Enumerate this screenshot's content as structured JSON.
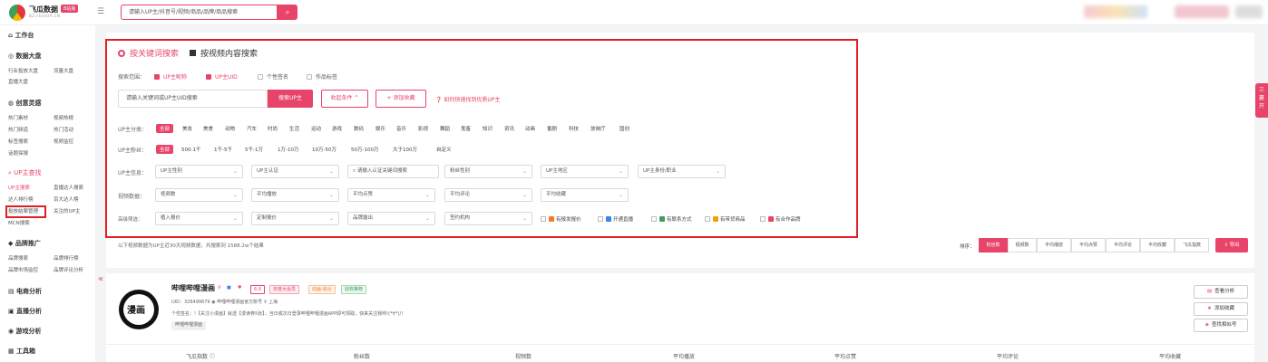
{
  "header": {
    "logo_title": "飞瓜数据",
    "logo_badge": "B站版",
    "logo_sub": "BZ.FEIGUA.CN",
    "menu_icon": "☰",
    "search_placeholder": "请输入UP主/抖音号/视频/商品/品牌/商品搜索",
    "search_icon": "⌕"
  },
  "sidebar": {
    "groups": [
      {
        "title": "⌂ 工作台"
      },
      {
        "title": "◎ 数据大盘"
      },
      {
        "title": "◍ 创意灵感"
      },
      {
        "title": "⌕ UP主查找"
      },
      {
        "title": "◆ 品牌推广"
      },
      {
        "title": "▤ 电商分析"
      },
      {
        "title": "▣ 直播分析"
      },
      {
        "title": "◉ 游戏分析"
      },
      {
        "title": "▦ 工具箱"
      }
    ],
    "items": [
      "行业投放大盘",
      "流量大盘",
      "直播大盘",
      "热门素材",
      "视频热榜",
      "热门频道",
      "热门活动",
      "标签搜索",
      "视频监控",
      "话题探搜",
      "UP主搜索",
      "直播达人搜索",
      "达人排行榜",
      "百大达人榜",
      "投放结案管理",
      "关注的UP主",
      "MCN搜索",
      "品牌搜索",
      "品牌排行榜",
      "品牌市场监控",
      "品牌评论分析"
    ],
    "collapse_icon": "«"
  },
  "search_panel": {
    "tab_keyword": "按关键词搜索",
    "tab_video": "按视频内容搜索",
    "scope_label": "搜索范围：",
    "scope_options": [
      {
        "label": "UP主昵称",
        "checked": true
      },
      {
        "label": "UP主UID",
        "checked": true
      },
      {
        "label": "个性签名",
        "checked": false
      },
      {
        "label": "作品标签",
        "checked": false
      }
    ],
    "keyword_placeholder": "请输入关键词或UP主UID搜索",
    "search_button": "搜索UP主",
    "collect_button": "收起条件 ^",
    "add_collection_button": "+ 添加收藏",
    "help_text": "❓ 如何快速找到优质UP主",
    "category_label": "UP主分类：",
    "categories": [
      "全部",
      "美妆",
      "美食",
      "动物",
      "汽车",
      "时尚",
      "生活",
      "运动",
      "游戏",
      "数码",
      "娱乐",
      "音乐",
      "影视",
      "舞蹈",
      "鬼畜",
      "知识",
      "资讯",
      "动画",
      "番剧",
      "科技",
      "放映厅",
      "国创"
    ],
    "fans_label": "UP主粉丝：",
    "fans_ranges": [
      "全部",
      "500-1千",
      "1千-5千",
      "5千-1万",
      "1万-10万",
      "10万-50万",
      "50万-100万",
      "大于100万",
      "自定义"
    ],
    "info_label": "UP主信息：",
    "info_dropdowns": [
      "UP主性别",
      "UP主认证",
      "⌕ 请输入认证关键词搜索",
      "粉丝性别",
      "UP主地区",
      "UP主身份/职业"
    ],
    "video_label": "视频数据：",
    "video_dropdowns": [
      "视频数",
      "平均播放",
      "平均点赞",
      "平均评论",
      "平均收藏"
    ],
    "advanced_label": "高级筛选：",
    "advanced_dropdowns": [
      "植入报价",
      "定制报价",
      "品牌露出",
      "签约机构"
    ],
    "advanced_checks": [
      {
        "label": "有报发报价",
        "color": "#f07c2a"
      },
      {
        "label": "开通直播",
        "color": "#3b82f6"
      },
      {
        "label": "有联系方式",
        "color": "#3aa05a"
      },
      {
        "label": "有带货商品",
        "color": "#f59e0b"
      },
      {
        "label": "有合作品牌",
        "color": "#e8446a"
      }
    ]
  },
  "results_bar": {
    "summary": "以下视频数据为UP主近30天视频数据，共搜索到 1588.2w个结果",
    "sort_label": "排序：",
    "sort_options": [
      "粉丝数",
      "视频数",
      "平均播放",
      "平均点赞",
      "平均评论",
      "平均收藏",
      "飞瓜指数"
    ],
    "export_button": "导出"
  },
  "side_tab": "三\n赢\n开",
  "result_card": {
    "avatar_text": "漫画",
    "name": "哔哩哔哩漫画",
    "tags": [
      "6.6",
      "年度大会员",
      "动画·综合",
      "授权推荐"
    ],
    "uid_line": "UID：326499679  ◉ 哔哩哔哩漫画官方账号  ⚲ 上海",
    "signature": "个性签名：!【关注小漫画】就送【漫读券5张】，当日或次日登录哔哩哔哩漫画APP即可领取，快来关注我哟!(*∀*)/！",
    "category_tag": "哔哩哔哩漫画",
    "actions": [
      {
        "icon": "▤",
        "label": "查看分析"
      },
      {
        "icon": "★",
        "label": "添加收藏"
      },
      {
        "icon": "◈",
        "label": "查找相似号"
      }
    ],
    "columns": [
      "飞瓜指数 ⓘ",
      "粉丝数",
      "视频数",
      "平均播放",
      "平均点赞",
      "平均评论",
      "平均收藏"
    ]
  },
  "colors": {
    "accent": "#e8446a",
    "highlight_box": "#e02020"
  }
}
